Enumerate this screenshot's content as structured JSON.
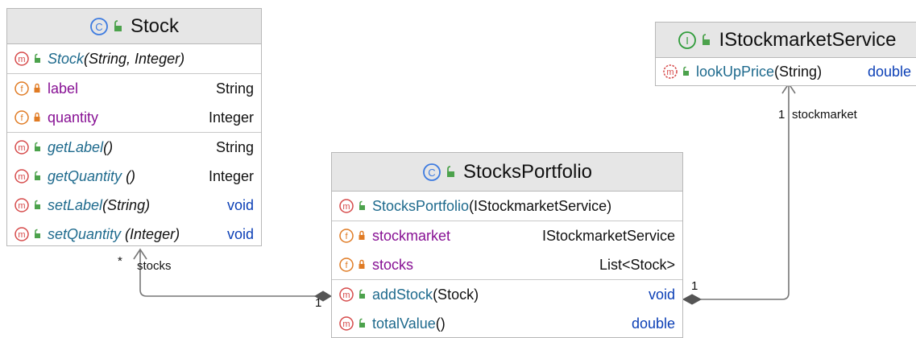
{
  "classes": {
    "stock": {
      "name": "Stock",
      "constructor": {
        "name": "Stock",
        "params": "(String, Integer)"
      },
      "fields": [
        {
          "name": "label",
          "type": "String"
        },
        {
          "name": "quantity",
          "type": "Integer"
        }
      ],
      "methods": [
        {
          "name": "getLabel",
          "params": "()",
          "type": "String"
        },
        {
          "name": "getQuantity",
          "params": " ()",
          "type": "Integer"
        },
        {
          "name": "setLabel",
          "params": "(String)",
          "type": "void"
        },
        {
          "name": "setQuantity",
          "params": " (Integer)",
          "type": "void"
        }
      ]
    },
    "portfolio": {
      "name": "StocksPortfolio",
      "constructor": {
        "name": "StocksPortfolio",
        "params": "(IStockmarketService)"
      },
      "fields": [
        {
          "name": "stockmarket",
          "type": "IStockmarketService"
        },
        {
          "name": "stocks",
          "type": "List<Stock>"
        }
      ],
      "methods": [
        {
          "name": "addStock",
          "params": "(Stock)",
          "type": "void"
        },
        {
          "name": "totalValue",
          "params": "()",
          "type": "double"
        }
      ]
    },
    "service": {
      "name": "IStockmarketService",
      "methods": [
        {
          "name": "lookUpPrice",
          "params": "(String)",
          "type": "double"
        }
      ]
    }
  },
  "icons": {
    "class": "C",
    "interface": "I",
    "method": "m",
    "field": "f"
  },
  "connectors": {
    "stocks": {
      "role": "stocks",
      "source_mult": "*",
      "target_mult": "1"
    },
    "stockmarket": {
      "role": "stockmarket",
      "source_mult": "1",
      "target_mult": "1"
    }
  },
  "colors": {
    "class_icon": "#3d7be0",
    "interface_icon": "#2f9c3a",
    "method_icon": "#d64a4a",
    "field_icon": "#e07b24",
    "lock": "#e07b24",
    "public": "#4ca24c",
    "header_bg": "#e6e6e6",
    "keyword": "#0b3fb6"
  }
}
